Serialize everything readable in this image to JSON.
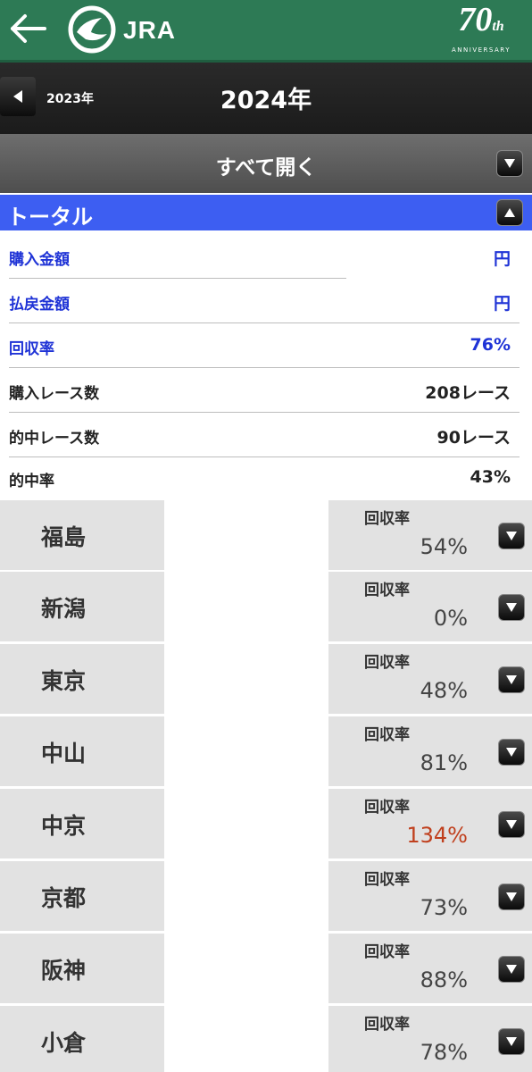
{
  "header": {
    "brand": "JRA",
    "anniversary": {
      "number": "70",
      "suffix": "th",
      "word": "ANNIVERSARY"
    }
  },
  "year_nav": {
    "prev_year": "2023年",
    "current_year": "2024年"
  },
  "expand_all": {
    "label": "すべて開く"
  },
  "total": {
    "title": "トータル",
    "rows": [
      {
        "label": "購入金額",
        "value": "円"
      },
      {
        "label": "払戻金額",
        "value": "円"
      },
      {
        "label": "回収率",
        "value": "76%"
      },
      {
        "label": "購入レース数",
        "value": "208レース"
      },
      {
        "label": "的中レース数",
        "value": "90レース"
      },
      {
        "label": "的中率",
        "value": "43%"
      }
    ]
  },
  "venues": [
    {
      "name": "福島",
      "rate_label": "回収率",
      "rate": "54%"
    },
    {
      "name": "新潟",
      "rate_label": "回収率",
      "rate": "0%"
    },
    {
      "name": "東京",
      "rate_label": "回収率",
      "rate": "48%"
    },
    {
      "name": "中山",
      "rate_label": "回収率",
      "rate": "81%"
    },
    {
      "name": "中京",
      "rate_label": "回収率",
      "rate": "134%"
    },
    {
      "name": "京都",
      "rate_label": "回収率",
      "rate": "73%"
    },
    {
      "name": "阪神",
      "rate_label": "回収率",
      "rate": "88%"
    },
    {
      "name": "小倉",
      "rate_label": "回収率",
      "rate": "78%"
    }
  ],
  "colors": {
    "header_green": "#2d7a55",
    "total_blue": "#3d5ef2",
    "label_blue": "#1f33d6",
    "high_rate": "#c0401e"
  }
}
